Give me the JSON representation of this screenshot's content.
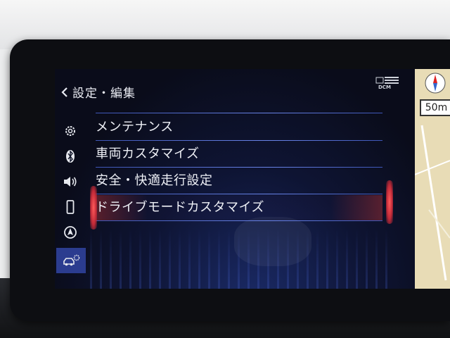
{
  "header": {
    "title": "設定・編集"
  },
  "status": {
    "dcm_label": "DCM"
  },
  "sidebar": {
    "items": [
      {
        "icon": "gear-icon"
      },
      {
        "icon": "bluetooth-icon"
      },
      {
        "icon": "speaker-icon"
      },
      {
        "icon": "phone-icon"
      },
      {
        "icon": "navigation-icon"
      },
      {
        "icon": "car-settings-icon",
        "active": true
      }
    ]
  },
  "menu": {
    "items": [
      {
        "label": "メンテナンス"
      },
      {
        "label": "車両カスタマイズ"
      },
      {
        "label": "安全・快適走行設定"
      },
      {
        "label": "ドライブモードカスタマイズ",
        "selected": true
      }
    ]
  },
  "map": {
    "scale_label": "50m"
  },
  "colors": {
    "accent": "#2b3c8f",
    "highlight": "#e04848",
    "separator": "#5b74d8"
  }
}
